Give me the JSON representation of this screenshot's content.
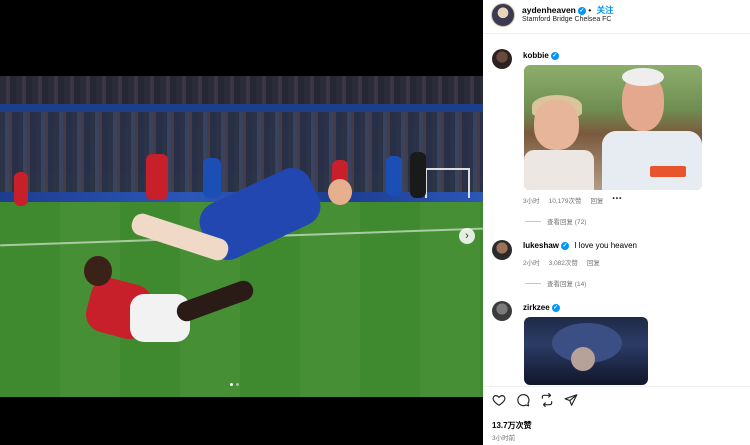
{
  "post": {
    "username": "aydenheaven",
    "follow_label": "关注",
    "location": "Stamford Bridge Chelsea FC",
    "likes": "13.7万次赞",
    "time": "3小时前"
  },
  "comments": [
    {
      "username": "kobbie",
      "text": "",
      "time": "3小时",
      "likes": "10,179次赞",
      "reply_label": "回复",
      "more_label": "•••",
      "view_replies": "查看回复 (72)"
    },
    {
      "username": "lukeshaw",
      "text": "I love you heaven",
      "time": "2小时",
      "likes": "3,082次赞",
      "reply_label": "回复",
      "view_replies": "查看回复 (14)"
    },
    {
      "username": "zirkzee",
      "text": ""
    }
  ],
  "media": {
    "next_arrow": "›",
    "slide_index": 1,
    "slide_count": 2
  },
  "icons": {
    "like": "heart-icon",
    "comment": "comment-icon",
    "repost": "repost-icon",
    "share": "send-icon",
    "verified": "verified-badge-icon"
  },
  "colors": {
    "accent": "#0095f6",
    "muted": "#737373"
  }
}
